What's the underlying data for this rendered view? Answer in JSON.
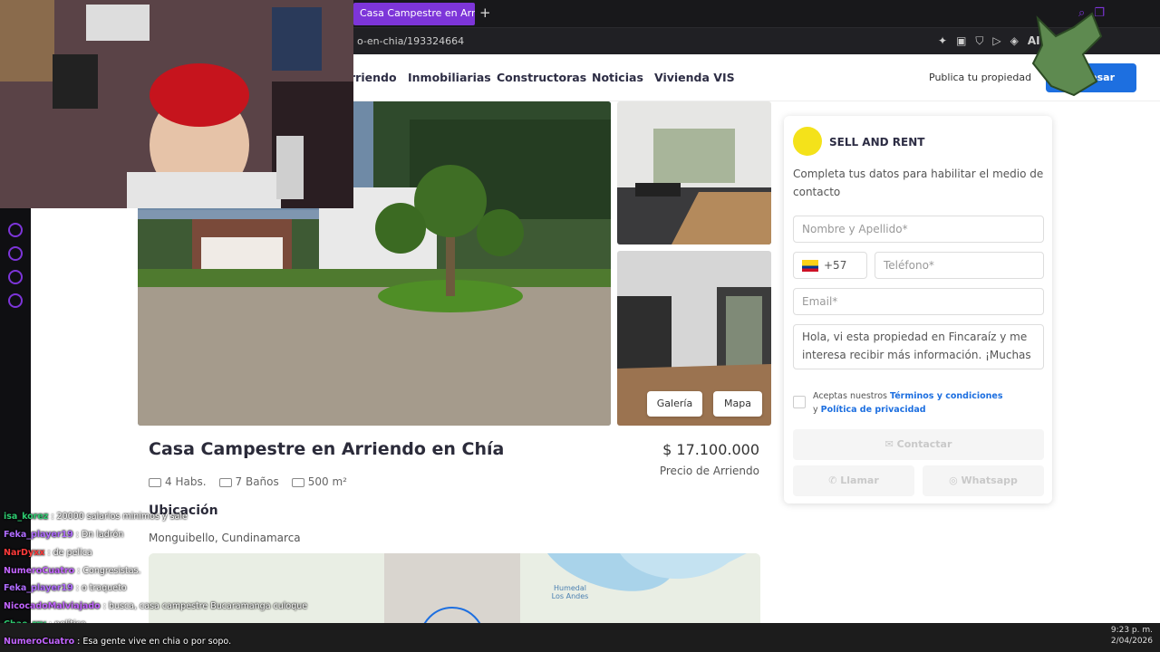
{
  "browser": {
    "tab_title": "Casa Campestre en Arriendo",
    "new_tab": "+",
    "url": "o-en-chia/193324664",
    "ai_label": "AI"
  },
  "nav": {
    "items": [
      "rriendo",
      "Inmobiliarias",
      "Constructoras",
      "Noticias",
      "Vivienda VIS"
    ],
    "publica": "Publica tu propiedad",
    "ingresar": "Ingresar"
  },
  "gallery": {
    "galeria": "Galería",
    "mapa": "Mapa"
  },
  "listing": {
    "title": "Casa Campestre en Arriendo en Chía",
    "price": "$ 17.100.000",
    "price_label": "Precio de Arriendo",
    "habs": "4 Habs.",
    "banos": "7 Baños",
    "area": "500 m²",
    "ubicacion": "Ubicación",
    "location": "Monguibello, Cundinamarca",
    "map_label": "Humedal Los Andes"
  },
  "contact": {
    "brand": "SELL AND RENT",
    "intro": "Completa tus datos para habilitar el medio de contacto",
    "name_placeholder": "Nombre y Apellido*",
    "country_code": "+57",
    "phone_placeholder": "Teléfono*",
    "email_placeholder": "Email*",
    "message": "Hola, vi esta propiedad en Fincaraíz y me interesa recibir más información. ¡Muchas",
    "terms_prefix": "Aceptas nuestros",
    "terms_link": "Términos y condiciones",
    "terms_and": "y",
    "privacy_link": "Política de privacidad",
    "contactar": "Contactar",
    "llamar": "Llamar",
    "whatsapp": "Whatsapp"
  },
  "chat": [
    {
      "user": "isa_korez",
      "text": ": 20000 salarios minimos y sale",
      "color": "#2ecc71"
    },
    {
      "user": "Feka_player19",
      "text": ": Dn ladrón",
      "color": "#b06cff"
    },
    {
      "user": "NarDyxx",
      "text": ": de pelica",
      "color": "#ff3b3b"
    },
    {
      "user": "NumeroCuatro",
      "text": ": Congresistas.",
      "color": "#c264ff"
    },
    {
      "user": "Feka_player19",
      "text": ": o traqueto",
      "color": "#b06cff"
    },
    {
      "user": "NicocadoMalviajado",
      "text": ": busca, casa campestre Bucaramanga culoque",
      "color": "#c264ff"
    },
    {
      "user": "Chae_rry",
      "text": ": político",
      "color": "#2ecc71"
    },
    {
      "user": "NumeroCuatro",
      "text": ": Esa gente vive en chia o por sopo.",
      "color": "#c264ff"
    }
  ],
  "clock": {
    "time": "9:23 p. m.",
    "date": "2/04/2026"
  }
}
